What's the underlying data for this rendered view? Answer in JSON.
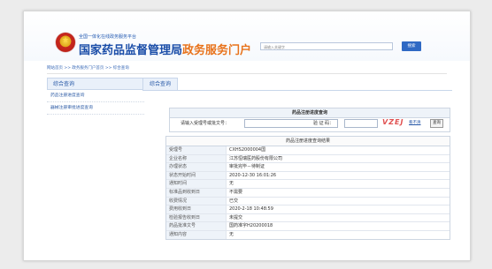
{
  "header": {
    "sub_title": "全国一体化在线政务服务平台",
    "main_title": "国家药品监督管理局",
    "main_title_suffix": "政务服务门户",
    "search_placeholder": "请输入关键字",
    "search_button": "搜索"
  },
  "breadcrumb": "网站首页 >> 政务服务门户首页 >> 综合查询",
  "sidebar": {
    "heading": "综合查询",
    "items": [
      {
        "label": "药品注册进度查询"
      },
      {
        "label": "器械注册审批进度查询"
      }
    ]
  },
  "tabs": [
    {
      "label": "综合查询"
    }
  ],
  "query": {
    "title": "药品注册进度查询",
    "label_acceptance": "请输入受理号或批文号：",
    "label_captcha": "验 证 码：",
    "captcha_text": "VZEJ",
    "refresh_label": "看不清",
    "submit_label": "查询"
  },
  "result": {
    "title": "药品注册进度查询结果",
    "rows": [
      {
        "label": "受理号",
        "value": "CXHS2000004国"
      },
      {
        "label": "企业名称",
        "value": "江苏恒瑞医药股份有限公司"
      },
      {
        "label": "办理状态",
        "value": "审批完毕－待制证"
      },
      {
        "label": "状态开始时间",
        "value": "2020-12-30 16:01:26"
      },
      {
        "label": "通知时间",
        "value": "无"
      },
      {
        "label": "标准品到收到日",
        "value": "不需要"
      },
      {
        "label": "收费情况",
        "value": "已交"
      },
      {
        "label": "费用收到日",
        "value": "2020-2-18 10:48:59"
      },
      {
        "label": "检验报告收到日",
        "value": "未提交"
      },
      {
        "label": "药品批准文号",
        "value": "国药准字H20200018"
      },
      {
        "label": "通知内容",
        "value": "无"
      }
    ]
  }
}
